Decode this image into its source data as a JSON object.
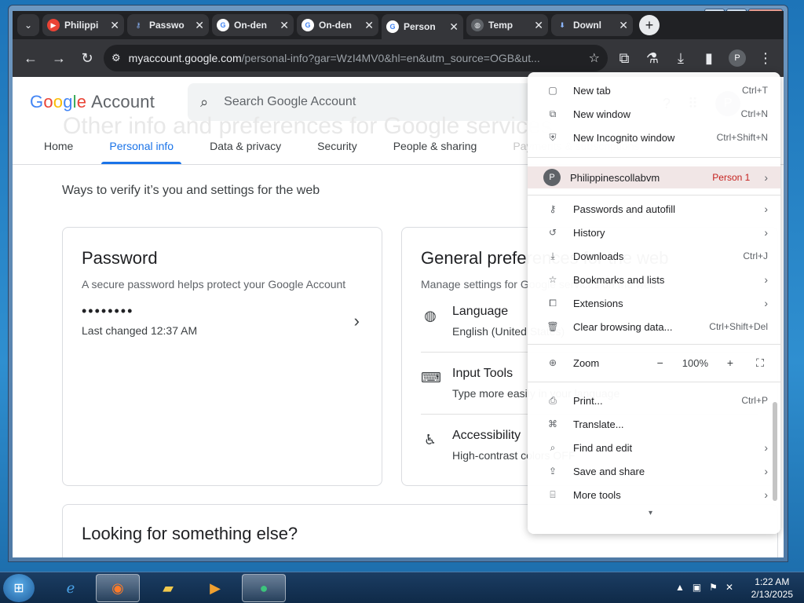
{
  "browser": {
    "tabs": [
      {
        "title": "Philippi",
        "fav_color": "#ea4335",
        "fav_icon": "youtube-icon",
        "active": false
      },
      {
        "title": "Passwo",
        "fav_color": "#8ab4f8",
        "fav_icon": "key-icon",
        "active": false
      },
      {
        "title": "On-den",
        "fav_color": "#ffffff",
        "fav_icon": "google-icon",
        "active": false
      },
      {
        "title": "On-den",
        "fav_color": "#ffffff",
        "fav_icon": "google-icon",
        "active": false
      },
      {
        "title": "Person",
        "fav_color": "#ffffff",
        "fav_icon": "google-icon",
        "active": true
      },
      {
        "title": "Temp",
        "fav_color": "#9aa0a6",
        "fav_icon": "globe-icon",
        "active": false
      },
      {
        "title": "Downl",
        "fav_color": "#8ab4f8",
        "fav_icon": "download-icon",
        "active": false
      }
    ],
    "url_host": "myaccount.google.com",
    "url_rest": "/personal-info?gar=WzI4MV0&hl=en&utm_source=OGB&ut...",
    "profile_initial": "P"
  },
  "page": {
    "logo": {
      "g1": "G",
      "o1": "o",
      "o2": "o",
      "g2": "g",
      "l": "l",
      "e": "e",
      "account": "Account"
    },
    "search_placeholder": "Search Google Account",
    "avatar_initial": "P",
    "nav": [
      "Home",
      "Personal info",
      "Data & privacy",
      "Security",
      "People & sharing",
      "Payments & subscriptions"
    ],
    "ghost_heading": "Other info and preferences for Google services",
    "subtitle": "Ways to verify it’s you and settings for the web",
    "password_card": {
      "title": "Password",
      "desc": "A secure password helps protect your Google Account",
      "dots": "••••••••",
      "changed": "Last changed 12:37 AM"
    },
    "prefs_card": {
      "title": "General preferences for the web",
      "desc": "Manage settings for Google services on the web",
      "rows": [
        {
          "title": "Language",
          "value": "English (United States)",
          "icon": "globe-icon"
        },
        {
          "title": "Input Tools",
          "value": "Type more easily in your language",
          "icon": "keyboard-icon"
        },
        {
          "title": "Accessibility",
          "value": "High-contrast colors OFF",
          "icon": "accessibility-icon"
        }
      ]
    },
    "looking_title": "Looking for something else?"
  },
  "menu": {
    "new_tab": {
      "label": "New tab",
      "shortcut": "Ctrl+T"
    },
    "new_window": {
      "label": "New window",
      "shortcut": "Ctrl+N"
    },
    "incognito": {
      "label": "New Incognito window",
      "shortcut": "Ctrl+Shift+N"
    },
    "profile": {
      "initial": "P",
      "name": "Philippinescollabvm",
      "badge": "Person 1"
    },
    "passwords": {
      "label": "Passwords and autofill"
    },
    "history": {
      "label": "History"
    },
    "downloads": {
      "label": "Downloads",
      "shortcut": "Ctrl+J"
    },
    "bookmarks": {
      "label": "Bookmarks and lists"
    },
    "extensions": {
      "label": "Extensions"
    },
    "clear": {
      "label": "Clear browsing data...",
      "shortcut": "Ctrl+Shift+Del"
    },
    "zoom": {
      "label": "Zoom",
      "minus": "−",
      "value": "100%",
      "plus": "+"
    },
    "print": {
      "label": "Print...",
      "shortcut": "Ctrl+P"
    },
    "translate": {
      "label": "Translate..."
    },
    "find": {
      "label": "Find and edit"
    },
    "save": {
      "label": "Save and share"
    },
    "more_tools": {
      "label": "More tools"
    }
  },
  "taskbar": {
    "clock_time": "1:22 AM",
    "clock_date": "2/13/2025"
  }
}
